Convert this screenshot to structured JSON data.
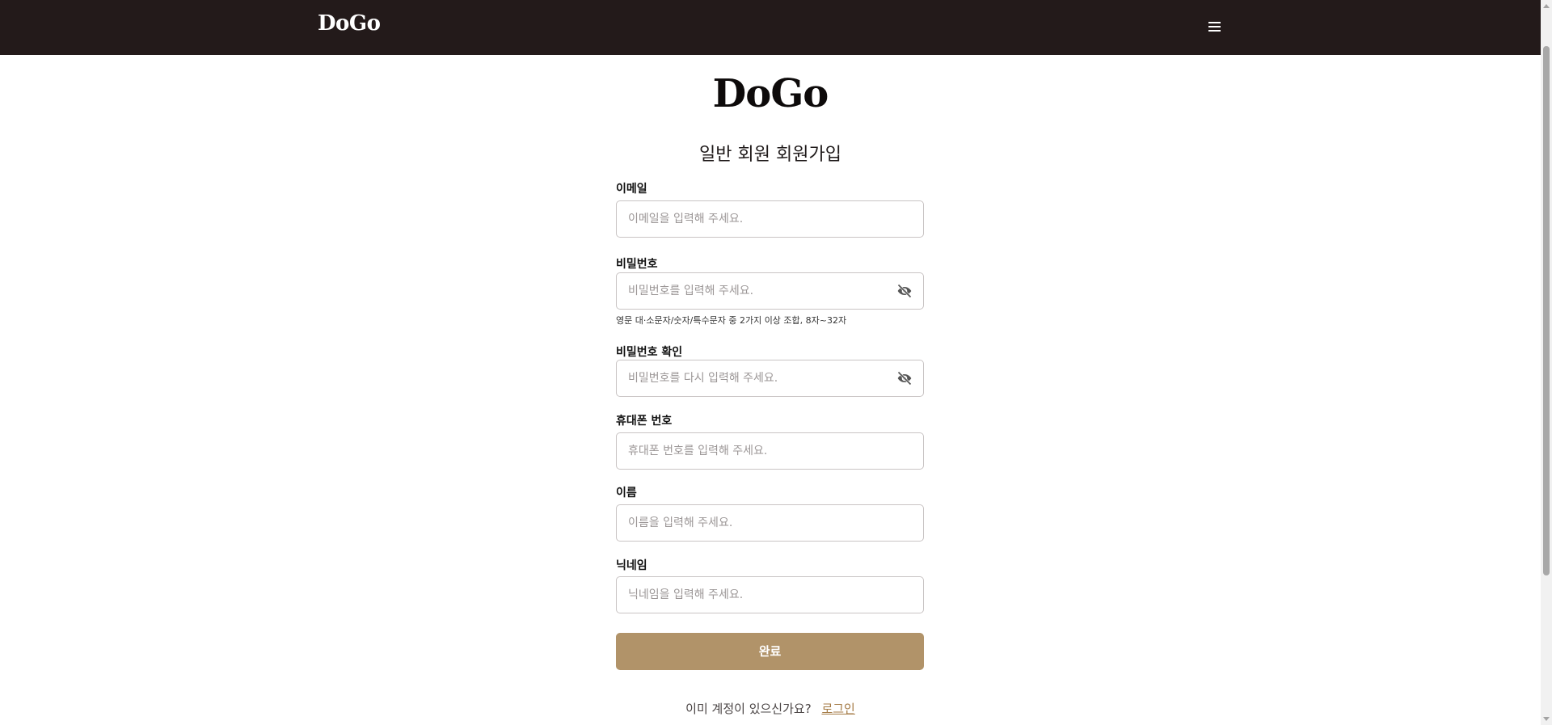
{
  "header": {
    "logo": "DoGo",
    "menu_icon": "hamburger-menu-icon"
  },
  "brand": "DoGo",
  "page_title": "일반 회원 회원가입",
  "form": {
    "email": {
      "label": "이메일",
      "placeholder": "이메일을 입력해 주세요.",
      "value": ""
    },
    "password": {
      "label": "비밀번호",
      "placeholder": "비밀번호를 입력해 주세요.",
      "value": "",
      "toggle_icon": "eye-slash-icon",
      "hint": "영문 대·소문자/숫자/특수문자 중 2가지 이상 조합, 8자~32자"
    },
    "password_confirm": {
      "label": "비밀번호 확인",
      "placeholder": "비밀번호를 다시 입력해 주세요.",
      "value": "",
      "toggle_icon": "eye-slash-icon"
    },
    "phone": {
      "label": "휴대폰 번호",
      "placeholder": "휴대폰 번호를 입력해 주세요.",
      "value": ""
    },
    "name": {
      "label": "이름",
      "placeholder": "이름을 입력해 주세요.",
      "value": ""
    },
    "nickname": {
      "label": "닉네임",
      "placeholder": "닉네임을 입력해 주세요.",
      "value": ""
    },
    "submit_label": "완료"
  },
  "footer": {
    "question": "이미 계정이 있으신가요?",
    "login_link": "로그인"
  },
  "colors": {
    "header_bg": "#231a1a",
    "submit_bg": "#b19369",
    "link": "#a47a45"
  }
}
